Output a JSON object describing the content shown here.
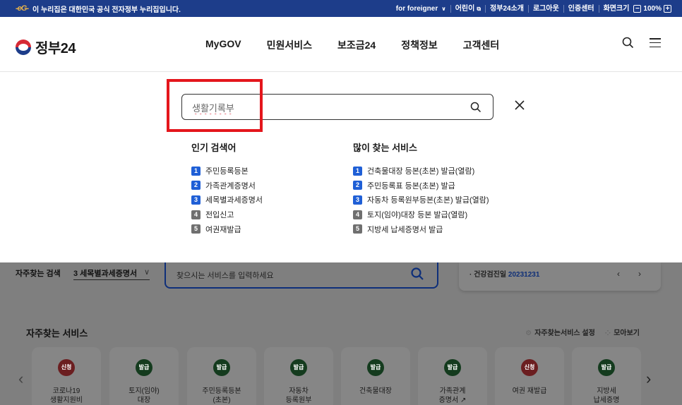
{
  "topbar": {
    "brand_mark": "-eG-",
    "notice": "이 누리집은 대한민국 공식 전자정부 누리집입니다.",
    "foreigner": "for foreigner",
    "kids": "어린이",
    "about": "정부24소개",
    "logout": "로그아웃",
    "auth": "인증센터",
    "screen_size": "화면크기",
    "zoom_value": "100%",
    "zoom_minus": "−",
    "zoom_plus": "+"
  },
  "header": {
    "logo": "정부24",
    "nav": [
      "MyGOV",
      "민원서비스",
      "보조금24",
      "정책정보",
      "고객센터"
    ]
  },
  "search": {
    "value": "생활기록부",
    "popular_title": "인기 검색어",
    "popular": [
      "주민등록등본",
      "가족관계증명서",
      "세목별과세증명서",
      "전입신고",
      "여권재발급"
    ],
    "services_title": "많이 찾는 서비스",
    "services": [
      "건축물대장 등본(초본) 발급(열람)",
      "주민등록표 등본(초본) 발급",
      "자동차 등록원부등본(초본) 발급(열람)",
      "토지(임야)대장 등본 발급(열람)",
      "지방세 납세증명서 발급"
    ],
    "rank_numbers": [
      "1",
      "2",
      "3",
      "4",
      "5"
    ]
  },
  "quick": {
    "label": "자주찾는 검색",
    "select_value": "3 세목별과세증명서",
    "input_placeholder": "찾으시는 서비스를 입력하세요",
    "notice_prefix": "· 건강검진일 ",
    "notice_value": "20231231"
  },
  "favorites": {
    "title": "자주찾는 서비스",
    "settings": "자주찾는서비스 설정",
    "view_all": "모아보기",
    "cards": [
      {
        "badge": "신청",
        "type": "apply",
        "label": "코로나19\n생활지원비"
      },
      {
        "badge": "발급",
        "type": "issue",
        "label": "토지(임야)\n대장"
      },
      {
        "badge": "발급",
        "type": "issue",
        "label": "주민등록등본\n(초본)"
      },
      {
        "badge": "발급",
        "type": "issue",
        "label": "자동차\n등록원부"
      },
      {
        "badge": "발급",
        "type": "issue",
        "label": "건축물대장"
      },
      {
        "badge": "발급",
        "type": "issue",
        "label": "가족관계\n증명서 ↗"
      },
      {
        "badge": "신청",
        "type": "apply",
        "label": "여권 재발급"
      },
      {
        "badge": "발급",
        "type": "issue",
        "label": "지방세\n납세증명"
      }
    ]
  },
  "colors": {
    "topbar_bg": "#1d3d8a",
    "highlight": "#e4161c",
    "rank_hot": "#1f5fd6",
    "rank_cold": "#6f6f6f"
  }
}
